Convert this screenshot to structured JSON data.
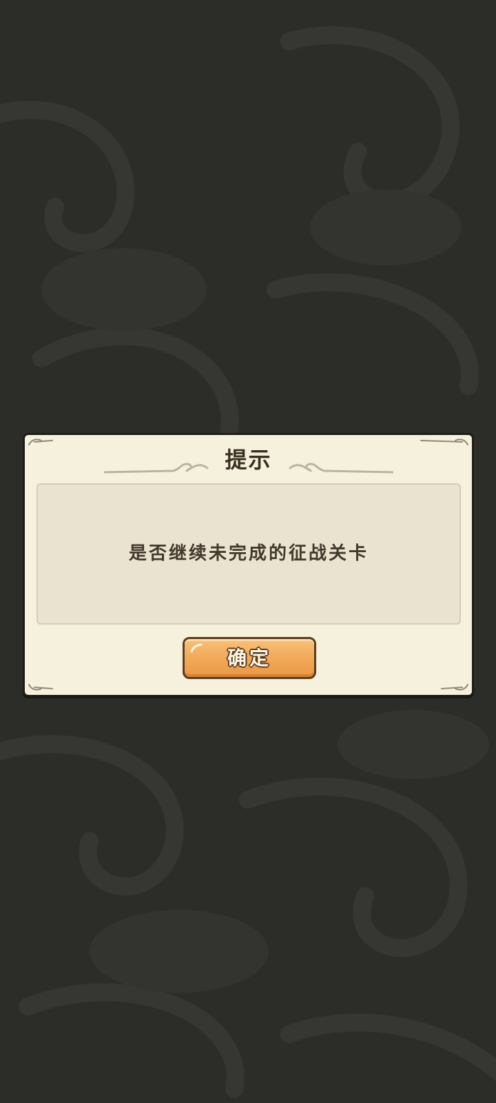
{
  "dialog": {
    "title": "提示",
    "message": "是否继续未完成的征战关卡",
    "confirm_label": "确定"
  },
  "colors": {
    "background": "#2c2c29",
    "dialog_fill": "#f6f1dd",
    "message_panel_fill": "#e9e3cf",
    "button_fill": "#f2ab5c",
    "button_border": "#5a3c1e",
    "title_text": "#3a2f22"
  },
  "icons": {
    "title_ornament": "cloud-scroll-ornament-icon",
    "background_pattern": "cloud-pattern-icon"
  }
}
